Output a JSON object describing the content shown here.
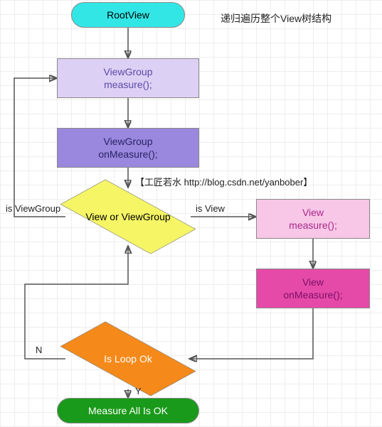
{
  "chart_data": {
    "type": "flowchart",
    "nodes": [
      {
        "id": "root",
        "type": "terminator",
        "label": "RootView"
      },
      {
        "id": "vg_measure",
        "type": "process",
        "label": "ViewGroup\nmeasure();"
      },
      {
        "id": "vg_onmeasure",
        "type": "process",
        "label": "ViewGroup\nonMeasure();"
      },
      {
        "id": "decision1",
        "type": "decision",
        "label": "View or ViewGroup"
      },
      {
        "id": "v_measure",
        "type": "process",
        "label": "View\nmeasure();"
      },
      {
        "id": "v_onmeasure",
        "type": "process",
        "label": "View\nonMeasure();"
      },
      {
        "id": "decision2",
        "type": "decision",
        "label": "Is Loop Ok"
      },
      {
        "id": "final",
        "type": "terminator",
        "label": "Measure All Is OK"
      }
    ],
    "edges": [
      {
        "from": "root",
        "to": "vg_measure"
      },
      {
        "from": "vg_measure",
        "to": "vg_onmeasure"
      },
      {
        "from": "vg_onmeasure",
        "to": "decision1"
      },
      {
        "from": "decision1",
        "to": "vg_measure",
        "label": "is ViewGroup"
      },
      {
        "from": "decision1",
        "to": "v_measure",
        "label": "is View"
      },
      {
        "from": "v_measure",
        "to": "v_onmeasure"
      },
      {
        "from": "v_onmeasure",
        "to": "decision2"
      },
      {
        "from": "decision2",
        "to": "decision1",
        "label": "N"
      },
      {
        "from": "decision2",
        "to": "final",
        "label": "Y"
      }
    ]
  },
  "labels": {
    "root": "RootView",
    "vg_measure_1": "ViewGroup",
    "vg_measure_2": "measure();",
    "vg_onmeasure_1": "ViewGroup",
    "vg_onmeasure_2": "onMeasure();",
    "decision1": "View or ViewGroup",
    "v_measure_1": "View",
    "v_measure_2": "measure();",
    "v_onmeasure_1": "View",
    "v_onmeasure_2": "onMeasure();",
    "decision2": "Is Loop Ok",
    "final": "Measure All Is OK",
    "edge_is_viewgroup": "is ViewGroup",
    "edge_is_view": "is View",
    "edge_no": "N",
    "edge_yes": "Y"
  },
  "annotations": {
    "title": "递归遍历整个View树结构",
    "watermark": "【工匠若水 http://blog.csdn.net/yanbober】"
  }
}
